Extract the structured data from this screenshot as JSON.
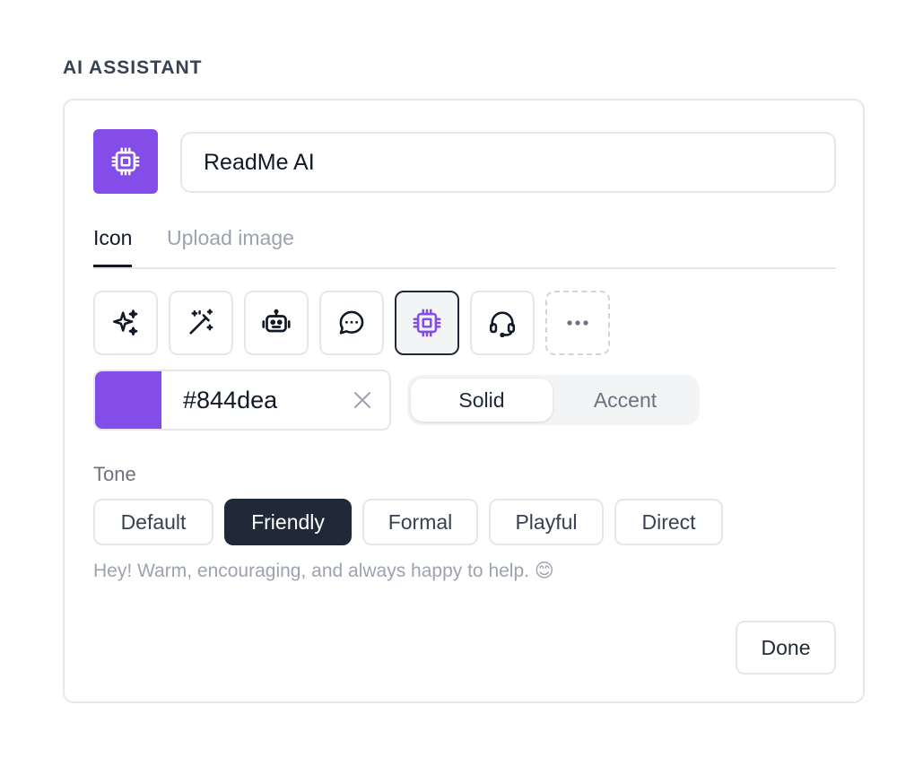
{
  "section": {
    "title": "AI ASSISTANT"
  },
  "assistant": {
    "name": "ReadMe AI",
    "avatar_icon": "chip-icon",
    "avatar_color": "#844dea"
  },
  "tabs": [
    {
      "label": "Icon",
      "active": true
    },
    {
      "label": "Upload image",
      "active": false
    }
  ],
  "icons": [
    {
      "name": "sparkles-icon"
    },
    {
      "name": "magic-wand-icon"
    },
    {
      "name": "robot-icon"
    },
    {
      "name": "chat-bubble-icon"
    },
    {
      "name": "chip-icon",
      "selected": true
    },
    {
      "name": "headset-icon"
    },
    {
      "name": "more-icon"
    }
  ],
  "color": {
    "hex": "#844dea",
    "clear_icon": "close-icon",
    "styles": [
      {
        "label": "Solid",
        "active": true
      },
      {
        "label": "Accent",
        "active": false
      }
    ]
  },
  "tone": {
    "label": "Tone",
    "options": [
      {
        "label": "Default",
        "active": false
      },
      {
        "label": "Friendly",
        "active": true
      },
      {
        "label": "Formal",
        "active": false
      },
      {
        "label": "Playful",
        "active": false
      },
      {
        "label": "Direct",
        "active": false
      }
    ],
    "description": "Hey! Warm, encouraging, and always happy to help. 😊"
  },
  "actions": {
    "done_label": "Done"
  },
  "colors": {
    "accent": "#844dea",
    "dark": "#1f2937",
    "border": "#e5e7eb"
  }
}
